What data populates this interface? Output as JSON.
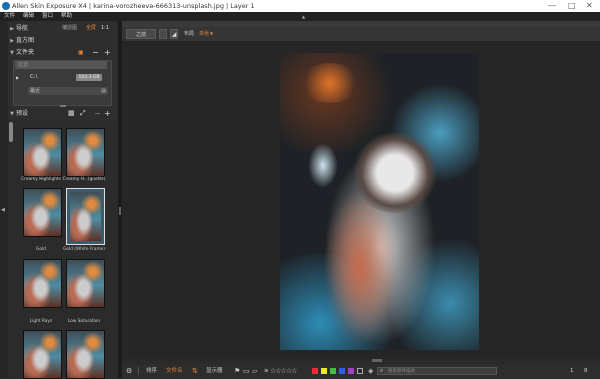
{
  "titlebar": {
    "title": "Allen Skin Exposure X4 | karina-vorozheeva-666313-unsplash.jpg | Layer 1"
  },
  "menubar": {
    "items": [
      "文件",
      "编辑",
      "窗口",
      "帮助"
    ]
  },
  "nav_panel": {
    "label": "导航",
    "fit": "捕捉图",
    "fit_active": "全屏",
    "ratio": "1:1"
  },
  "histogram_panel": {
    "label": "直方图"
  },
  "folder_panel": {
    "label": "文件夹",
    "filter_placeholder": "过滤",
    "drive": {
      "name": "C:\\",
      "size": "103.3 GB"
    },
    "favorite": "最近"
  },
  "presets_panel": {
    "label": "预设",
    "items": [
      {
        "label": "Creamy Highlights"
      },
      {
        "label": "Creamy H...(gnette)"
      },
      {
        "label": "Gold"
      },
      {
        "label": "Gold (White Frame)"
      },
      {
        "label": "Light Rays"
      },
      {
        "label": "Low Saturation"
      }
    ]
  },
  "toolbar": {
    "mode": "之前",
    "layout_label": "布局",
    "layout_value": "单张"
  },
  "bottombar": {
    "sort": "排序",
    "sort_value": "文件名",
    "filter": "显示器",
    "search_placeholder": "搜索部件描述",
    "count": "1",
    "flag_num": "8"
  },
  "colors": {
    "accent": "#e3843a",
    "labels": [
      "#e03030",
      "#e8e830",
      "#40c040",
      "#3060e0",
      "#a040c0"
    ]
  }
}
